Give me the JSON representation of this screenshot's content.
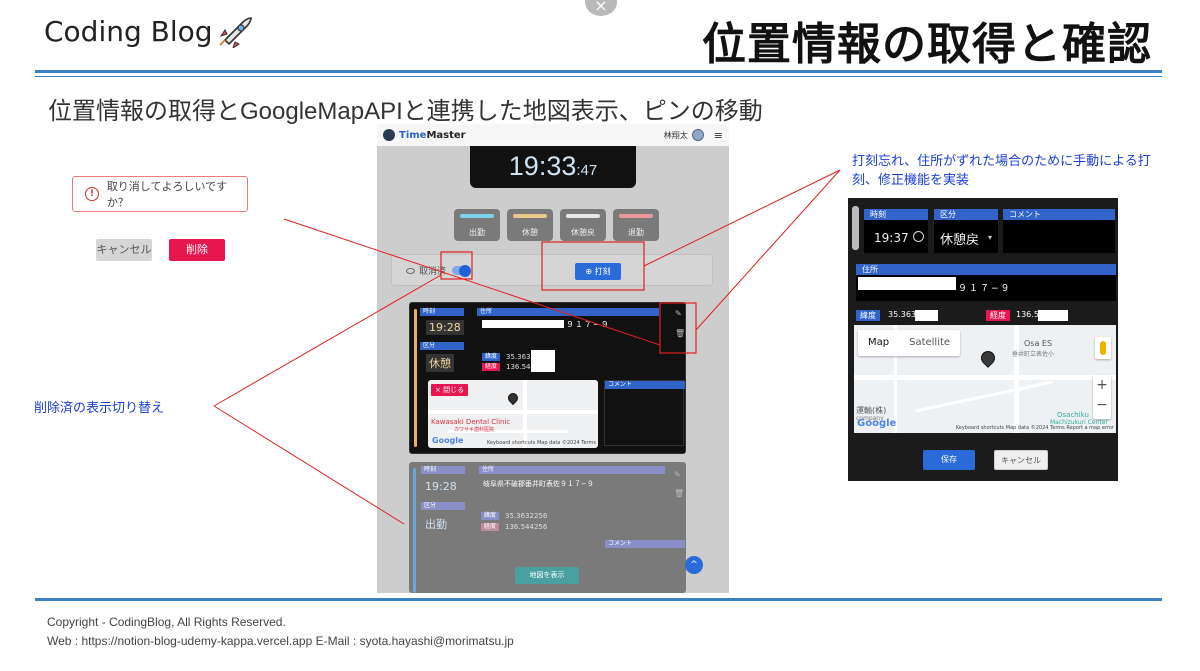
{
  "slide": {
    "brand": "Coding Blog",
    "title": "位置情報の取得と確認",
    "subtitle": "位置情報の取得とGoogleMapAPIと連携した地図表示、ピンの移動",
    "close_glyph": "×",
    "accent_color": "#3b7fc4"
  },
  "dialog": {
    "message": "取り消してよろしいですか？",
    "warn_glyph": "!",
    "cancel_label": "キャンセル",
    "delete_label": "削除"
  },
  "notes": {
    "left": "削除済の表示切り替え",
    "right": "打刻忘れ、住所がずれた場合のために手動による打刻、修正機能を実装",
    "color": "#1a3fd6"
  },
  "app": {
    "logo_prefix": "Time",
    "logo_suffix": "Master",
    "user_name": "林翔太",
    "menu_glyph": "≡",
    "clock_hm": "19:33",
    "clock_sec": ":47",
    "kind_buttons": [
      {
        "label": "出勤",
        "color": "#7fd1e8"
      },
      {
        "label": "休憩",
        "color": "#e9c98a"
      },
      {
        "label": "休憩戻",
        "color": "#e8e8e8"
      },
      {
        "label": "退勤",
        "color": "#e89a9a"
      }
    ],
    "toggle_label": "取消済",
    "stamp_label": "⊕ 打刻",
    "records": [
      {
        "time_label": "時刻",
        "time": "19:28",
        "kind_label": "区分",
        "kind": "休憩",
        "address_label": "住所",
        "address_tail": "９１７−９",
        "lat_label": "緯度",
        "lat": "35.363",
        "lng_label": "経度",
        "lng": "136.54",
        "map_close_label": "× 閉じる",
        "comment_label": "コメント",
        "map_place": "Kawasaki Dental Clinic",
        "map_place_sub": "カワサキ歯科医院",
        "google": "Google",
        "map_footer": "Keyboard shortcuts   Map data ©2024   Terms",
        "edit_glyph": "✎",
        "trash_glyph": "🗑"
      },
      {
        "time_label": "時刻",
        "time": "19:28",
        "kind_label": "区分",
        "kind": "出勤",
        "address_label": "住所",
        "address": "岐阜県不破郡垂井町表佐９１７−９",
        "lat_label": "緯度",
        "lat": "35.3632256",
        "lng_label": "経度",
        "lng": "136.544256",
        "comment_label": "コメント",
        "show_map_label": "地図を表示",
        "edit_glyph": "✎",
        "trash_glyph": "🗑"
      }
    ],
    "fab_glyph": "^"
  },
  "zoom_panel": {
    "time_label": "時刻",
    "time": "19:37",
    "kind_label": "区分",
    "kind": "休憩戻",
    "comment_label": "コメント",
    "address_label": "住所",
    "address_tail": "９１７−９",
    "lat_label": "緯度",
    "lat": "35.363",
    "lng_label": "経度",
    "lng": "136.5",
    "map_tab": "Map",
    "satellite_tab": "Satellite",
    "place_1": "Osa ES",
    "place_1_sub": "垂井町立表佐小",
    "place_2": "Osachiku",
    "place_2_sub": "Machizukuri Center",
    "place_3": "運輸(株)",
    "place_3_sub": "company",
    "google": "Google",
    "map_footer": "Keyboard shortcuts   Map data ©2024   Terms   Report a map error",
    "zoom_in": "+",
    "zoom_out": "−",
    "save_label": "保存",
    "cancel_label": "キャンセル"
  },
  "footer": {
    "copyright": "Copyright -    CodingBlog, All Rights Reserved.",
    "contact": "Web : https://notion-blog-udemy-kappa.vercel.app  E-Mail : syota.hayashi@morimatsu.jp"
  }
}
